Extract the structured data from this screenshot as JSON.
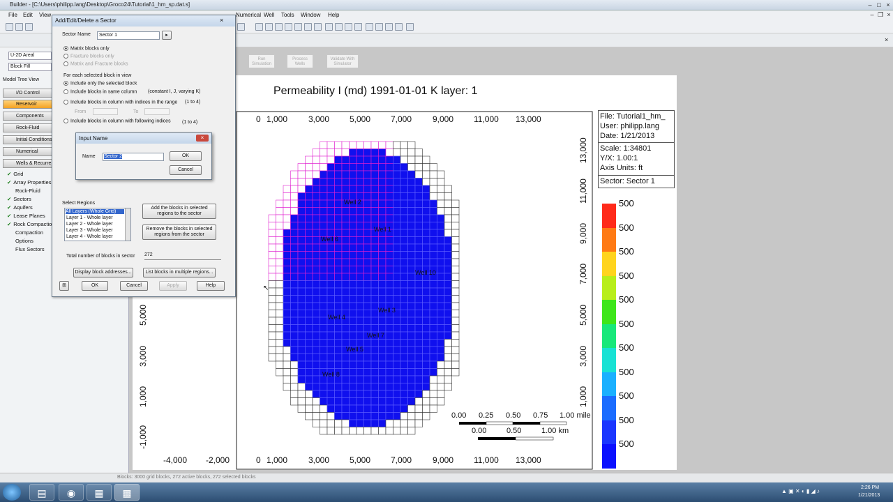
{
  "app": {
    "title": "Builder - [C:\\Users\\philipp.lang\\Desktop\\Groco24\\Tutorial\\1_hm_sp.dat.s]",
    "menus": [
      "File",
      "Edit",
      "View",
      "Numerical",
      "Well",
      "Tools",
      "Window",
      "Help"
    ]
  },
  "left_panel": {
    "combo1": "U-2D Areal",
    "combo2": "Block Fill",
    "tree_title": "Model Tree View",
    "groups": [
      "I/O Control",
      "Reservoir",
      "Components",
      "Rock-Fluid",
      "Initial Conditions",
      "Numerical",
      "Wells & Recurrent"
    ],
    "tree_items": [
      {
        "label": "Grid",
        "checked": true
      },
      {
        "label": "Array Properties",
        "checked": true
      },
      {
        "label": "Rock-Fluid",
        "checked": false
      },
      {
        "label": "Sectors",
        "checked": true
      },
      {
        "label": "Aquifers",
        "checked": true
      },
      {
        "label": "Lease Planes",
        "checked": true
      },
      {
        "label": "Rock Compaction",
        "checked": true
      },
      {
        "label": "Compaction",
        "checked": false
      },
      {
        "label": "Options",
        "checked": false
      },
      {
        "label": "Flux Sectors",
        "checked": false
      }
    ]
  },
  "run_buttons": [
    "Run Simulation",
    "Process Wells",
    "Validate With Simulator"
  ],
  "plot": {
    "title": "Permeability I (md) 1991-01-01      K layer: 1",
    "info": [
      "File: Tutorial1_hm_",
      "User:  philipp.lang",
      "Date:  1/21/2013",
      "Scale: 1:34801",
      "Y/X:  1.00:1",
      "Axis Units:  ft",
      "Sector: Sector 1"
    ],
    "x_ticks_top": [
      "0",
      "1,000",
      "3,000",
      "5,000",
      "7,000",
      "9,000",
      "11,000",
      "13,000"
    ],
    "x_ticks_bottom": [
      "-4,000",
      "-2,000",
      "0",
      "1,000",
      "3,000",
      "5,000",
      "7,000",
      "9,000",
      "11,000",
      "13,000"
    ],
    "y_ticks_right": [
      "13,000",
      "11,000",
      "9,000",
      "7,000",
      "5,000",
      "3,000",
      "1,000"
    ],
    "y_ticks_left": [
      "5,000",
      "3,000",
      "1,000",
      "-1,000"
    ],
    "legend_values": [
      "500",
      "500",
      "500",
      "500",
      "500",
      "500",
      "500",
      "500",
      "500",
      "500",
      "500"
    ],
    "legend_colors": [
      "#ff2a1a",
      "#ff7a14",
      "#ffd41e",
      "#b8ee1a",
      "#3ee61a",
      "#18e87a",
      "#18e2d4",
      "#1ab0ff",
      "#1a6cff",
      "#1a36ff",
      "#0a10ff"
    ],
    "wells": [
      "Well 2",
      "Well 1",
      "Well 6",
      "Well 10",
      "Well 4",
      "Well 3",
      "Well 7",
      "Well 5",
      "Well 8"
    ],
    "scalebar_miles": [
      "0.00",
      "0.25",
      "0.50",
      "0.75",
      "1.00 mile"
    ],
    "scalebar_km": [
      "0.00",
      "0.50",
      "1.00 km"
    ]
  },
  "sector_dialog": {
    "title": "Add/Edit/Delete a Sector",
    "sector_name_label": "Sector Name",
    "sector_name_value": "Sector 1",
    "radio1": "Matrix blocks only",
    "radio2": "Fracture blocks only",
    "radio3": "Matrix and Fracture blocks",
    "group_label": "For each selected block in view",
    "opt1": "Include only the selected block",
    "opt2": "Include blocks in same column",
    "opt2_note": "(constant I, J, varying K)",
    "opt3": "Include blocks in column with indices in the range",
    "opt3_note": "(1 to 4)",
    "from_label": "From",
    "to_label": "To",
    "opt4": "Include blocks in column with following indices",
    "opt4_note": "(1 to 4)",
    "select_regions_label": "Select Regions",
    "regions": [
      "All Layers (Whole Grid)",
      "Layer 1 - Whole layer",
      "Layer 2 - Whole layer",
      "Layer 3 - Whole layer",
      "Layer 4 - Whole layer"
    ],
    "add_regions_button": "Add the blocks in selected regions to the sector",
    "remove_regions_button": "Remove the blocks in selected regions from the sector",
    "total_label": "Total number of blocks in sector",
    "total_value": "272",
    "display_button": "Display block addresses...",
    "list_button": "List blocks in multiple regions...",
    "ok": "OK",
    "cancel": "Cancel",
    "apply": "Apply",
    "help": "Help"
  },
  "input_dialog": {
    "title": "Input Name",
    "name_label": "Name",
    "name_value": "Sector 2",
    "ok": "OK",
    "cancel": "Cancel"
  },
  "status": {
    "text": "Blocks: 3000 grid blocks, 272 active blocks, 272 selected blocks"
  },
  "clock": {
    "time": "2:26 PM",
    "date": "1/21/2013"
  }
}
